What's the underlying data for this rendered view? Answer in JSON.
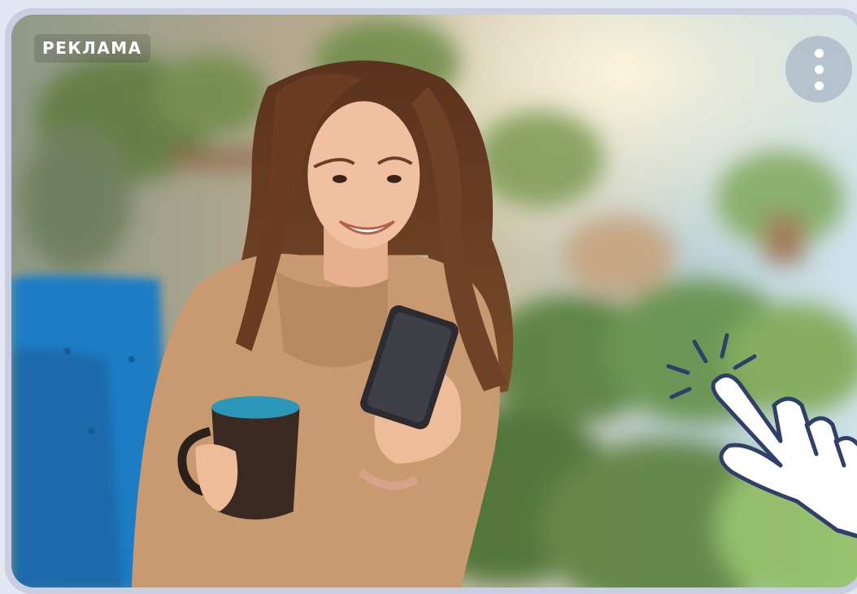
{
  "ad": {
    "label": "РЕКЛАМА",
    "menu_icon": "more-vertical-icon",
    "gesture_icon": "tap-hand-icon"
  },
  "colors": {
    "page_background": "#e3e7f4",
    "card_border": "#c9cee0",
    "label_text": "#ffffff"
  }
}
